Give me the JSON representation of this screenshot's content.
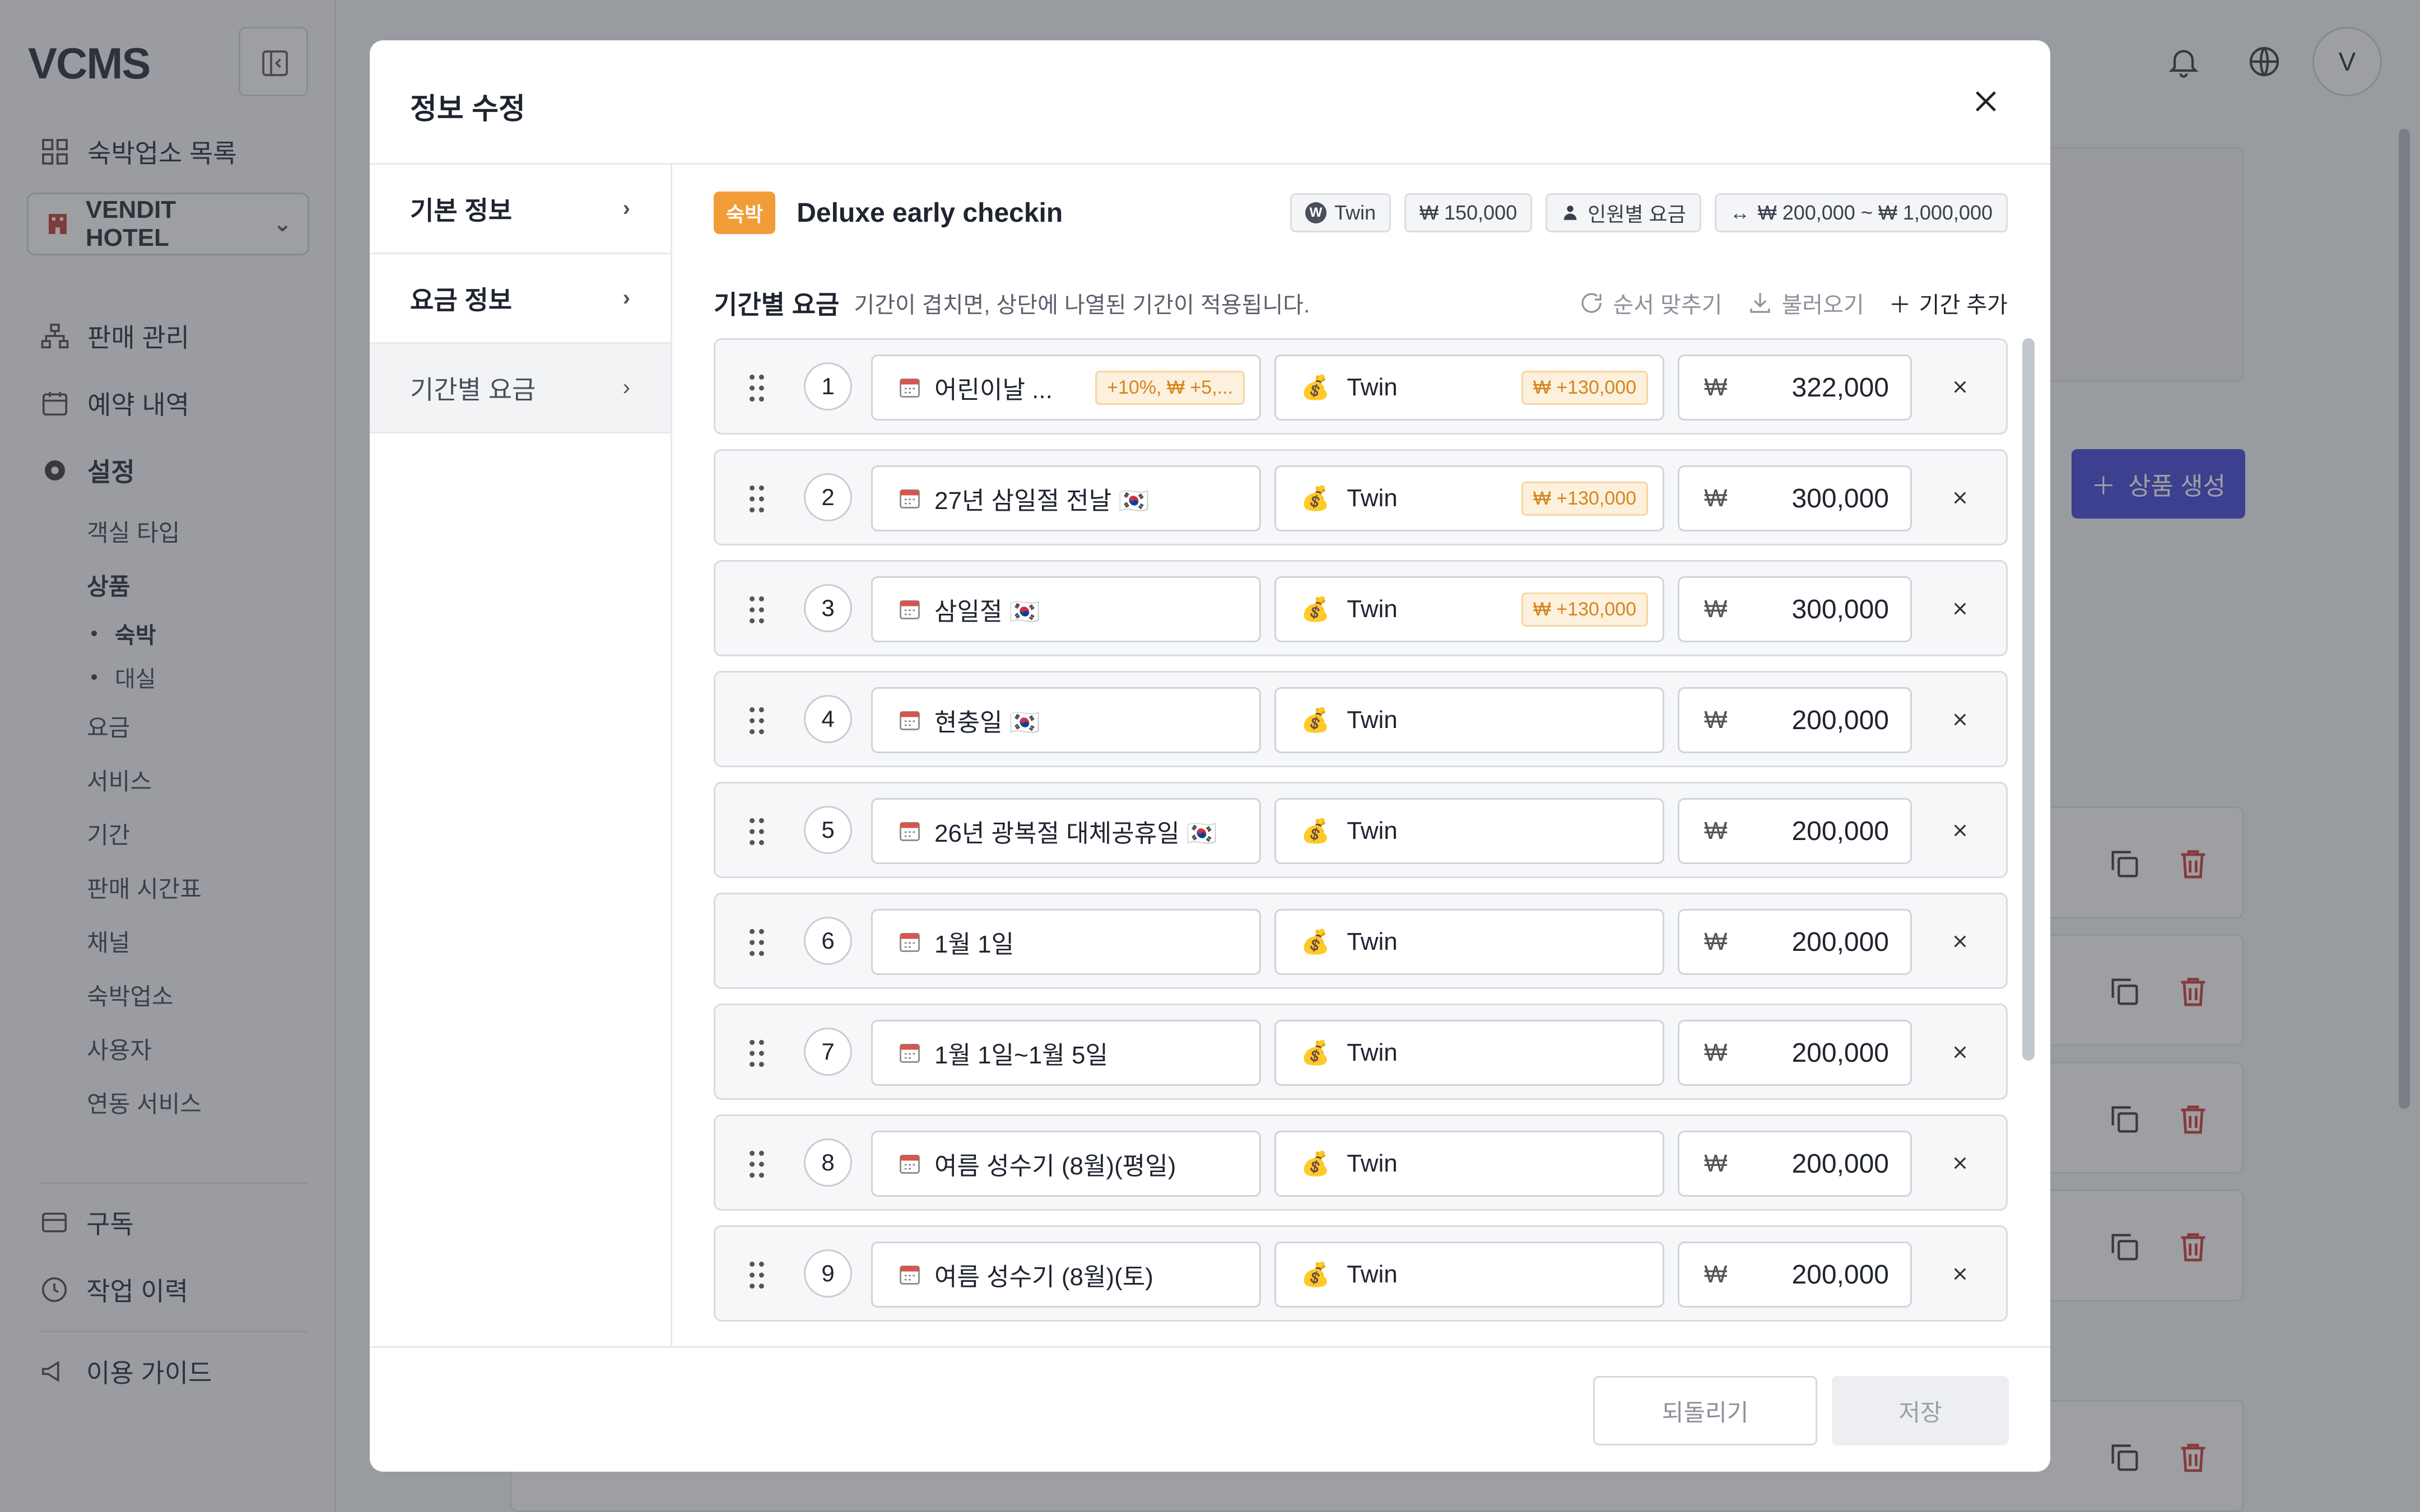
{
  "app": {
    "logo": "VCMS",
    "nav_top": "숙박업소 목록",
    "hotel": "VENDIT HOTEL",
    "nav": [
      {
        "label": "판매 관리"
      },
      {
        "label": "예약 내역"
      },
      {
        "label": "설정"
      }
    ],
    "settings_sub": [
      "객실 타입",
      "상품",
      "요금",
      "서비스",
      "기간",
      "판매 시간표",
      "채널",
      "숙박업소",
      "사용자",
      "연동 서비스"
    ],
    "product_sub": [
      "숙박",
      "대실"
    ],
    "bottom_nav": [
      "구독",
      "작업 이력",
      "이용 가이드"
    ],
    "avatar": "V",
    "create_button": "상품 생성"
  },
  "modal": {
    "title": "정보 수정",
    "left_nav": [
      "기본 정보",
      "요금 정보",
      "기간별 요금"
    ],
    "product": {
      "tag": "숙박",
      "name": "Deluxe early checkin",
      "chips": [
        "Twin",
        "₩ 150,000",
        "인원별 요금",
        "₩ 200,000 ~ ₩ 1,000,000"
      ]
    },
    "section": {
      "title": "기간별 요금",
      "desc": "기간이 겹치면, 상단에 나열된 기간이 적용됩니다.",
      "actions": [
        "순서 맞추기",
        "불러오기",
        "기간 추가"
      ]
    },
    "rows": [
      {
        "no": "1",
        "period": "어린이날 ...",
        "period_badge": "+10%, ₩ +5,...",
        "rate": "Twin",
        "rate_badge": "₩ +130,000",
        "price": "322,000"
      },
      {
        "no": "2",
        "period": "27년 삼일절 전날 🇰🇷",
        "period_badge": "",
        "rate": "Twin",
        "rate_badge": "₩ +130,000",
        "price": "300,000"
      },
      {
        "no": "3",
        "period": "삼일절 🇰🇷",
        "period_badge": "",
        "rate": "Twin",
        "rate_badge": "₩ +130,000",
        "price": "300,000"
      },
      {
        "no": "4",
        "period": "현충일 🇰🇷",
        "period_badge": "",
        "rate": "Twin",
        "rate_badge": "",
        "price": "200,000"
      },
      {
        "no": "5",
        "period": "26년 광복절 대체공휴일 🇰🇷",
        "period_badge": "",
        "rate": "Twin",
        "rate_badge": "",
        "price": "200,000"
      },
      {
        "no": "6",
        "period": "1월 1일",
        "period_badge": "",
        "rate": "Twin",
        "rate_badge": "",
        "price": "200,000"
      },
      {
        "no": "7",
        "period": "1월 1일~1월 5일",
        "period_badge": "",
        "rate": "Twin",
        "rate_badge": "",
        "price": "200,000"
      },
      {
        "no": "8",
        "period": "여름 성수기 (8월)(평일)",
        "period_badge": "",
        "rate": "Twin",
        "rate_badge": "",
        "price": "200,000"
      },
      {
        "no": "9",
        "period": "여름 성수기 (8월)(토)",
        "period_badge": "",
        "rate": "Twin",
        "rate_badge": "",
        "price": "200,000"
      }
    ],
    "currency": "₩",
    "footer": {
      "revert": "되돌리기",
      "save": "저장"
    }
  },
  "colors": {
    "accent": "#3f3fd6",
    "tag": "#f29c38",
    "badge_text": "#d4851e"
  }
}
